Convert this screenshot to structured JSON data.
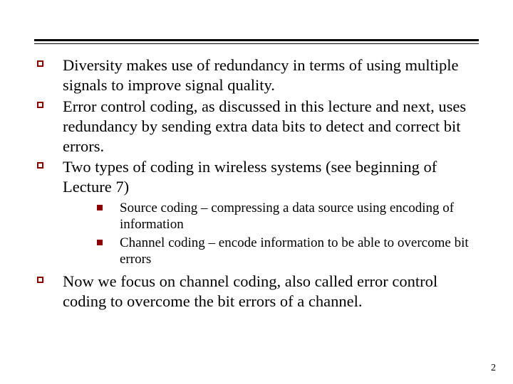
{
  "bullets": [
    {
      "text": "Diversity makes use of redundancy in terms of using multiple signals to improve signal quality."
    },
    {
      "text": "Error control coding, as discussed in this lecture and next, uses redundancy by sending extra data bits to detect and correct bit errors."
    },
    {
      "text": "Two types of coding in wireless systems (see beginning of Lecture 7)",
      "sub": [
        {
          "text": "Source coding – compressing a data source using encoding of information"
        },
        {
          "text": "Channel coding – encode information to be able to overcome bit errors"
        }
      ]
    },
    {
      "text": "Now we focus on channel coding, also called error control coding to overcome the bit errors of a channel."
    }
  ],
  "page_number": "2"
}
